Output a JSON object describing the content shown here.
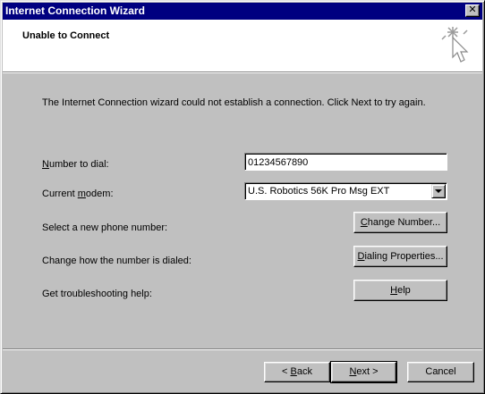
{
  "window": {
    "title": "Internet Connection Wizard",
    "close_glyph": "✕"
  },
  "header": {
    "title": "Unable to Connect",
    "icon": "wizard-sparkle-cursor-icon"
  },
  "message": "The Internet Connection wizard could not establish a connection. Click Next to try again.",
  "form": {
    "number_label": {
      "accel": "N",
      "rest": "umber to dial:"
    },
    "number_value": "01234567890",
    "modem_label": {
      "pre": "Current ",
      "accel": "m",
      "rest": "odem:"
    },
    "modem_value": "U.S. Robotics 56K Pro Msg EXT",
    "new_number_label": "Select a new phone number:",
    "dialing_label": "Change how the number is dialed:",
    "troubleshoot_label": "Get troubleshooting help:"
  },
  "buttons": {
    "change_number": {
      "accel": "C",
      "rest": "hange Number..."
    },
    "dialing_properties": {
      "accel": "D",
      "rest": "ialing Properties..."
    },
    "help": {
      "accel": "H",
      "rest": "elp"
    },
    "back": {
      "pre": "< ",
      "accel": "B",
      "rest": "ack"
    },
    "next": {
      "accel": "N",
      "rest": "ext >"
    },
    "cancel": "Cancel"
  },
  "colors": {
    "title_bar": "#000080",
    "face": "#c0c0c0",
    "header_bg": "#ffffff"
  }
}
